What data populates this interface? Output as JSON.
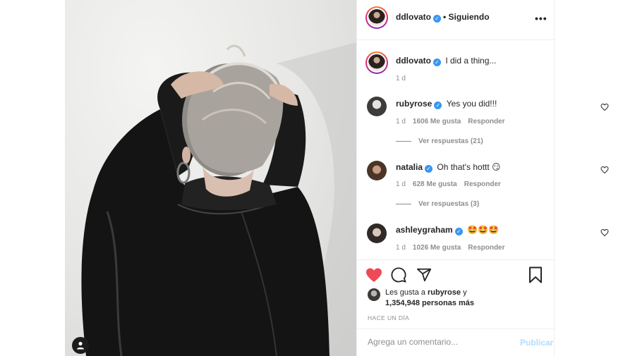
{
  "post": {
    "author": "ddlovato",
    "follow_status": "• Siguiendo",
    "more_icon": "more-horizontal-icon"
  },
  "caption": {
    "username": "ddlovato",
    "text": "I did a thing...",
    "time": "1 d"
  },
  "comments": [
    {
      "username": "rubyrose",
      "text": "Yes you did!!!",
      "time": "1 d",
      "likes": "1606 Me gusta",
      "reply": "Responder",
      "replies": "Ver respuestas (21)"
    },
    {
      "username": "natalia",
      "text": "Oh that's hottt 😏",
      "time": "1 d",
      "likes": "628 Me gusta",
      "reply": "Responder",
      "replies": "Ver respuestas (3)"
    },
    {
      "username": "ashleygraham",
      "text": "🤩🤩🤩",
      "time": "1 d",
      "likes": "1026 Me gusta",
      "reply": "Responder"
    }
  ],
  "likes": {
    "prefix": "Les gusta a",
    "user": "rubyrose",
    "joiner": "y",
    "count": "1,354,948 personas más"
  },
  "time_ago": "HACE UN DÍA",
  "comment_box": {
    "placeholder": "Agrega un comentario...",
    "publish_label": "Publicar"
  },
  "colors": {
    "heart": "#ed4956",
    "verified": "#3897f0",
    "publish_disabled": "#b3dbff"
  }
}
